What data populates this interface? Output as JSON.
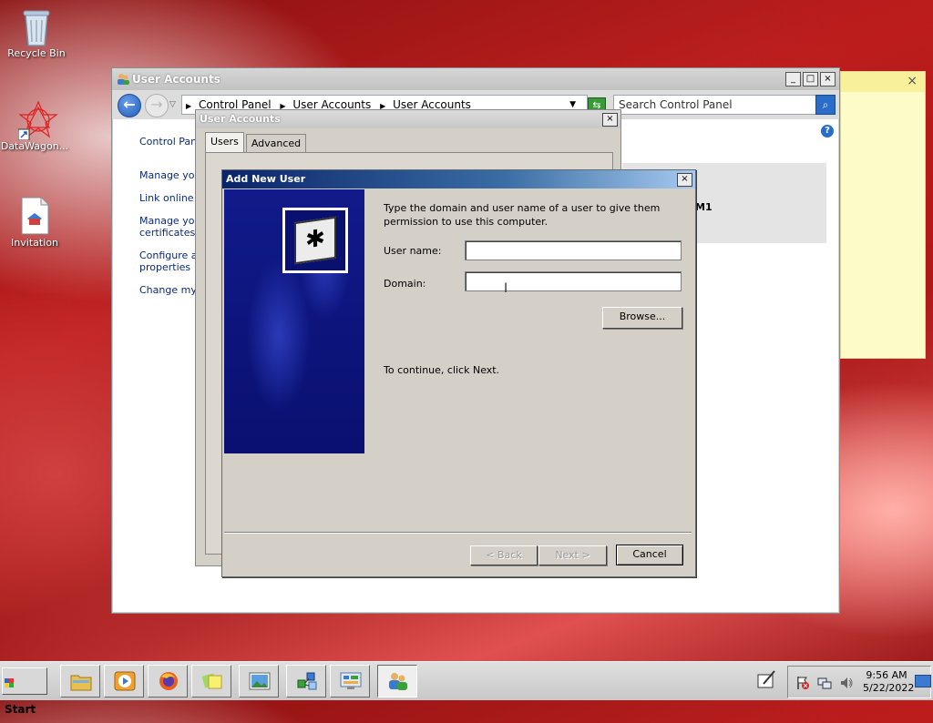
{
  "desktop": {
    "icons": [
      {
        "label": "Recycle Bin"
      },
      {
        "label": "DataWagon..."
      },
      {
        "label": "Invitation"
      }
    ]
  },
  "sticky_note": {
    "close": "×"
  },
  "ua_window": {
    "title": "User Accounts",
    "buttons": {
      "minimize": "_",
      "maximize": "□",
      "close": "×"
    },
    "breadcrumbs": [
      "Control Panel",
      "User Accounts",
      "User Accounts"
    ],
    "search_placeholder": "Search Control Panel",
    "help": "?",
    "sidebar": [
      "Control Panel",
      "Manage your",
      "Link online ID",
      "Manage your",
      "certificates",
      "Configure ad",
      "properties",
      "Change my e"
    ],
    "right_panel_text": "M1"
  },
  "mid_dialog": {
    "title": "User Accounts",
    "close": "×",
    "tabs": [
      "Users",
      "Advanced"
    ]
  },
  "wizard": {
    "title": "Add New User",
    "close": "×",
    "intro": "Type the domain and user name of a user to give them permission to use this computer.",
    "username_label": "User name:",
    "username_value": "",
    "domain_label": "Domain:",
    "domain_value": "",
    "browse": "Browse...",
    "continue_text": "To continue, click Next.",
    "back": "< Back",
    "next": "Next >",
    "cancel": "Cancel"
  },
  "taskbar": {
    "start": "Start",
    "time": "9:56 AM",
    "date": "5/22/2022"
  }
}
